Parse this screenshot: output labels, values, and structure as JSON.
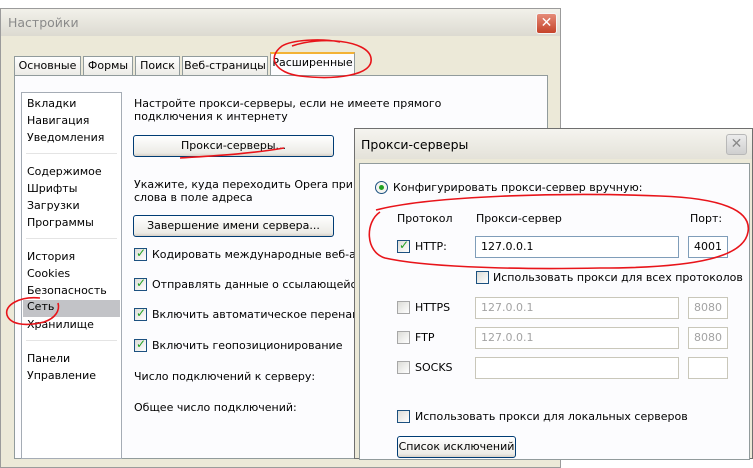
{
  "main_window": {
    "title": "Настройки",
    "tabs": [
      "Основные",
      "Формы",
      "Поиск",
      "Веб-страницы",
      "Расширенные"
    ],
    "active_tab": "Расширенные",
    "sidebar": [
      "Вкладки",
      "Навигация",
      "Уведомления",
      "Содержимое",
      "Шрифты",
      "Загрузки",
      "Программы",
      "История",
      "Cookies",
      "Безопасность",
      "Сеть",
      "Хранилище",
      "Панели",
      "Управление"
    ],
    "selected_sidebar_item": "Сеть",
    "proxy_desc_line1": "Настройте прокси-серверы, если не имеете прямого",
    "proxy_desc_line2": "подключения к интернету",
    "proxy_button": "Прокси-серверы...",
    "completion_desc_line1": "Укажите, куда переходить Opera при вво",
    "completion_desc_line2": "слова в поле адреса",
    "completion_button": "Завершение имени сервера...",
    "checkboxes": [
      {
        "label": "Кодировать международные веб-адре",
        "checked": true
      },
      {
        "label": "Отправлять данные о ссылающейся ст",
        "checked": true
      },
      {
        "label": "Включить автоматическое перенаправ",
        "checked": true
      },
      {
        "label": "Включить геопозиционирование",
        "checked": true
      }
    ],
    "connections_per_server_label": "Число подключений к серверу:",
    "total_connections_label": "Общее число подключений:"
  },
  "proxy_dialog": {
    "title": "Прокси-серверы",
    "manual_config_label": "Конфигурировать прокси-сервер вручную:",
    "col_protocol": "Протокол",
    "col_proxy": "Прокси-сервер",
    "col_port": "Порт:",
    "rows": [
      {
        "protocol": "HTTP:",
        "checked": true,
        "server": "127.0.0.1",
        "port": "4001",
        "enabled": true
      },
      {
        "protocol": "HTTPS",
        "checked": false,
        "server": "127.0.0.1",
        "port": "8080",
        "enabled": false
      },
      {
        "protocol": "FTP",
        "checked": false,
        "server": "127.0.0.1",
        "port": "8080",
        "enabled": false
      },
      {
        "protocol": "SOCKS",
        "checked": false,
        "server": "",
        "port": "",
        "enabled": false
      }
    ],
    "use_for_all_label": "Использовать прокси для всех протоколов",
    "use_for_local_label": "Использовать прокси для локальных серверов",
    "exceptions_button": "Список исключений"
  },
  "colors": {
    "annotation_red": "#e8141a",
    "checkmark_green": "#21a121",
    "selected_item_bg": "#c2c3c7"
  }
}
